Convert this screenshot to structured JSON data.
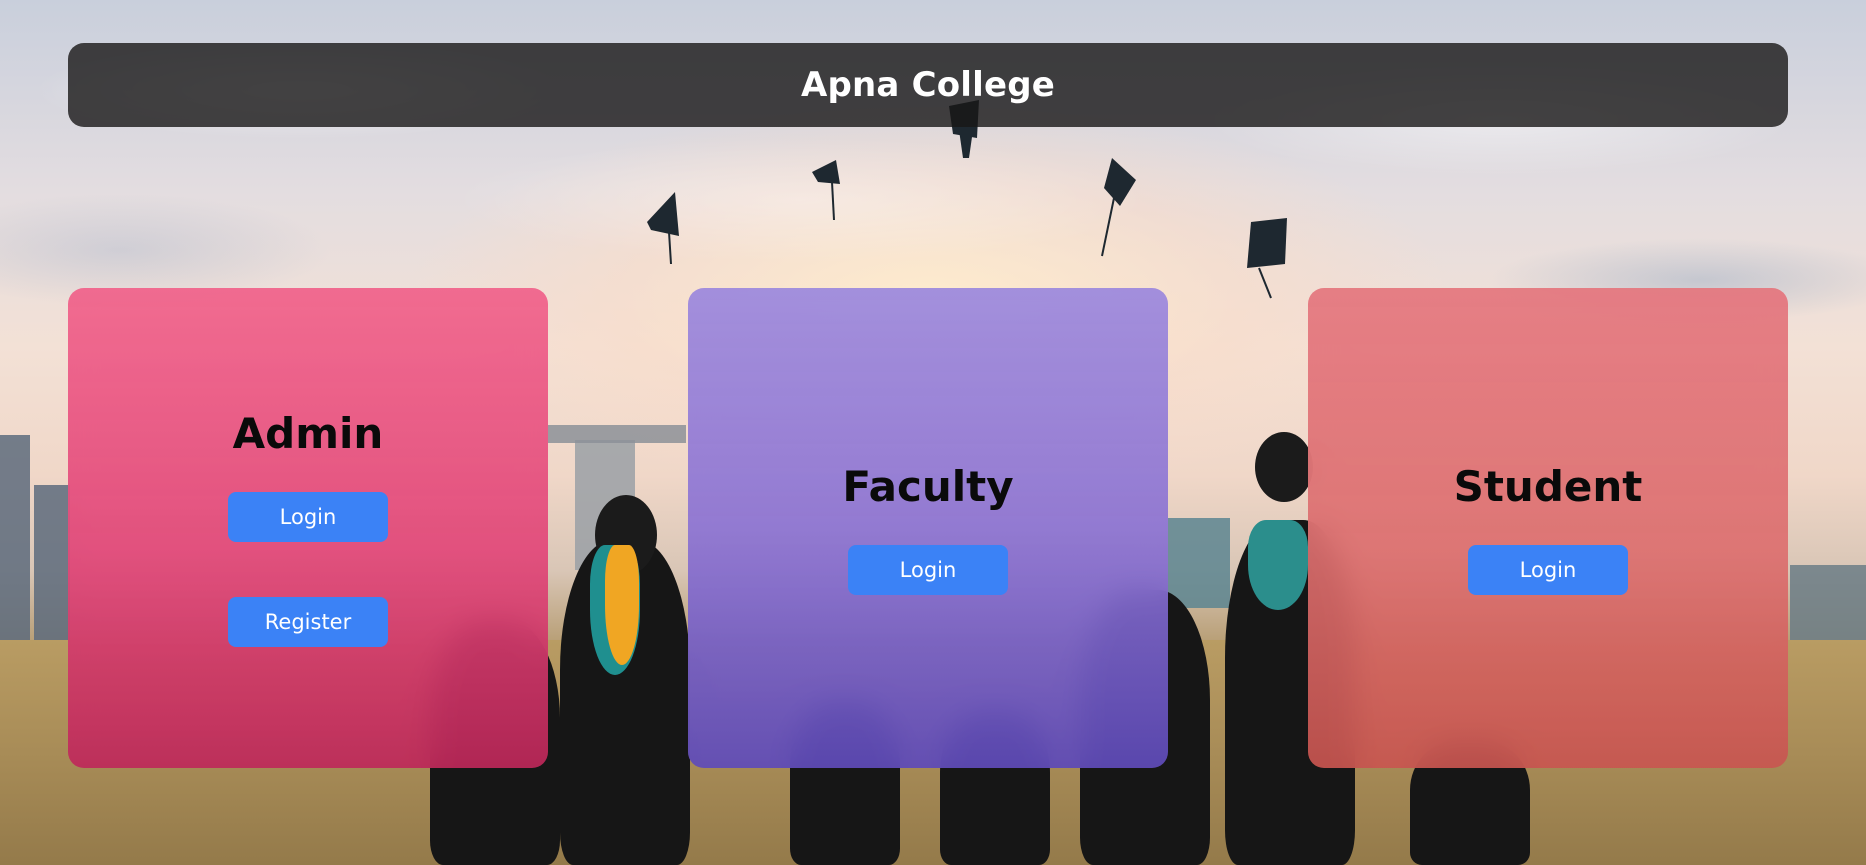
{
  "header": {
    "title": "Apna College"
  },
  "cards": {
    "admin": {
      "title": "Admin",
      "login_label": "Login",
      "register_label": "Register"
    },
    "faculty": {
      "title": "Faculty",
      "login_label": "Login"
    },
    "student": {
      "title": "Student",
      "login_label": "Login"
    }
  },
  "colors": {
    "button": "#3b82f6",
    "header_bg": "#181616",
    "admin_card": "#e8567f",
    "faculty_card": "#9a86d8",
    "student_card": "#d96e72"
  },
  "background": {
    "scene": "graduation-caps-sky-photo"
  }
}
